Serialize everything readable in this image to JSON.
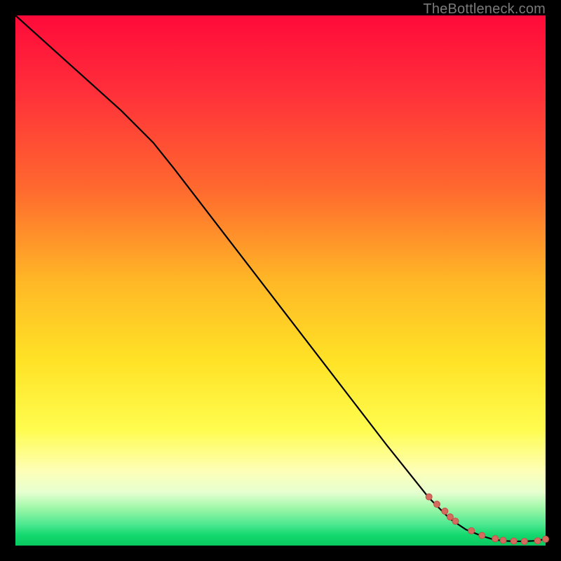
{
  "watermark": "TheBottleneck.com",
  "chart_data": {
    "type": "line",
    "title": "",
    "xlabel": "",
    "ylabel": "",
    "xlim": [
      0,
      100
    ],
    "ylim": [
      0,
      100
    ],
    "series": [
      {
        "name": "curve",
        "x": [
          0,
          10,
          20,
          26,
          30,
          40,
          50,
          60,
          70,
          78,
          82,
          85,
          88,
          90,
          92,
          94,
          96,
          98,
          100
        ],
        "y": [
          100,
          91,
          82,
          76,
          71,
          58,
          45,
          32,
          19,
          9,
          5,
          3,
          1.8,
          1.2,
          0.9,
          0.8,
          0.8,
          0.9,
          1.2
        ]
      }
    ],
    "points": {
      "name": "dots",
      "x": [
        78,
        79.5,
        81,
        82,
        83,
        86,
        88,
        90.5,
        92,
        94,
        96,
        98.5,
        100
      ],
      "y": [
        9.2,
        7.8,
        6.5,
        5.4,
        4.6,
        2.8,
        1.9,
        1.3,
        1.0,
        0.85,
        0.8,
        0.9,
        1.2
      ]
    }
  }
}
